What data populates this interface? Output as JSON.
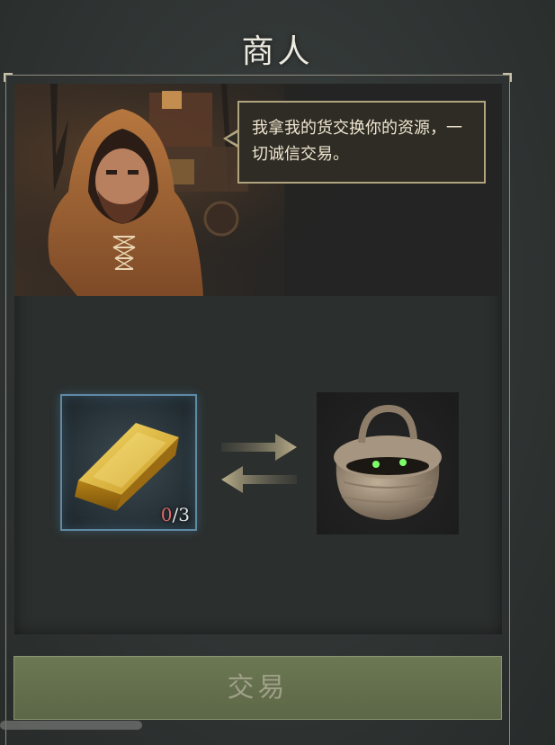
{
  "header": {
    "title": "商人"
  },
  "merchant": {
    "dialogue": "我拿我的货交换你的资源，一切诚信交易。"
  },
  "trade": {
    "give_item": {
      "name": "gold-bar",
      "count_current": "0",
      "count_sep_total": "/3"
    },
    "receive_item": {
      "name": "woven-basket"
    }
  },
  "actions": {
    "trade_label": "交易"
  },
  "colors": {
    "accent_button": "#66704e",
    "slot_border": "#5e8aa4",
    "count_short": "#e06a6a"
  }
}
